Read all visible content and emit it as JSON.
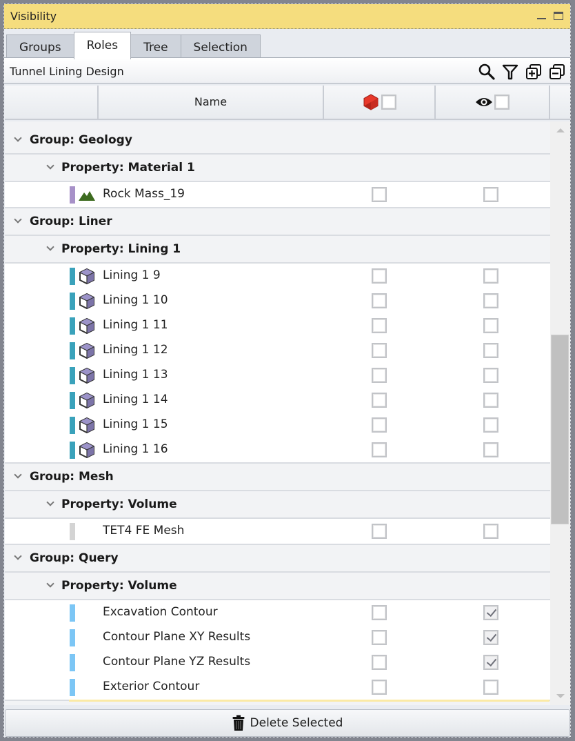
{
  "window": {
    "title": "Visibility",
    "minimize_icon": "minimize-icon",
    "maximize_icon": "maximize-icon"
  },
  "tabs": [
    {
      "label": "Groups",
      "active": false
    },
    {
      "label": "Roles",
      "active": true
    },
    {
      "label": "Tree",
      "active": false
    },
    {
      "label": "Selection",
      "active": false
    }
  ],
  "toolbar": {
    "document_name": "Tunnel Lining Design",
    "icons": [
      "search-icon",
      "filter-icon",
      "expand-all-icon",
      "collapse-all-icon"
    ]
  },
  "columns": {
    "name_header": "Name",
    "col1_icon": "red-hexagon-icon",
    "col1_checked": false,
    "col2_icon": "eye-icon",
    "col2_checked": false
  },
  "groups": [
    {
      "label": "Group: Geology",
      "properties": [
        {
          "label": "Property: Material 1",
          "items": [
            {
              "name": "Rock Mass_19",
              "bar_color": "#a791c8",
              "icon": "mountain-icon",
              "c1": false,
              "c2": false
            }
          ]
        }
      ]
    },
    {
      "label": "Group: Liner",
      "properties": [
        {
          "label": "Property: Lining 1",
          "items": [
            {
              "name": "Lining 1 9",
              "bar_color": "#3aa2bb",
              "icon": "cube-icon",
              "c1": false,
              "c2": false
            },
            {
              "name": "Lining 1 10",
              "bar_color": "#3aa2bb",
              "icon": "cube-icon",
              "c1": false,
              "c2": false
            },
            {
              "name": "Lining 1 11",
              "bar_color": "#3aa2bb",
              "icon": "cube-icon",
              "c1": false,
              "c2": false
            },
            {
              "name": "Lining 1 12",
              "bar_color": "#3aa2bb",
              "icon": "cube-icon",
              "c1": false,
              "c2": false
            },
            {
              "name": "Lining 1 13",
              "bar_color": "#3aa2bb",
              "icon": "cube-icon",
              "c1": false,
              "c2": false
            },
            {
              "name": "Lining 1 14",
              "bar_color": "#3aa2bb",
              "icon": "cube-icon",
              "c1": false,
              "c2": false
            },
            {
              "name": "Lining 1 15",
              "bar_color": "#3aa2bb",
              "icon": "cube-icon",
              "c1": false,
              "c2": false
            },
            {
              "name": "Lining 1 16",
              "bar_color": "#3aa2bb",
              "icon": "cube-icon",
              "c1": false,
              "c2": false
            }
          ]
        }
      ]
    },
    {
      "label": "Group: Mesh",
      "properties": [
        {
          "label": "Property: Volume",
          "items": [
            {
              "name": "TET4 FE Mesh",
              "bar_color": "#d4d4d4",
              "icon": "",
              "c1": false,
              "c2": false
            }
          ]
        }
      ]
    },
    {
      "label": "Group: Query",
      "properties": [
        {
          "label": "Property: Volume",
          "items": [
            {
              "name": "Excavation Contour",
              "bar_color": "#7cc6f5",
              "icon": "",
              "c1": false,
              "c2": true
            },
            {
              "name": "Contour Plane XY Results",
              "bar_color": "#7cc6f5",
              "icon": "",
              "c1": false,
              "c2": true
            },
            {
              "name": "Contour Plane YZ Results",
              "bar_color": "#7cc6f5",
              "icon": "",
              "c1": false,
              "c2": true
            },
            {
              "name": "Exterior Contour",
              "bar_color": "#7cc6f5",
              "icon": "",
              "c1": false,
              "c2": false
            }
          ]
        }
      ]
    }
  ],
  "footer": {
    "delete_label": "Delete Selected",
    "delete_icon": "trash-icon"
  }
}
